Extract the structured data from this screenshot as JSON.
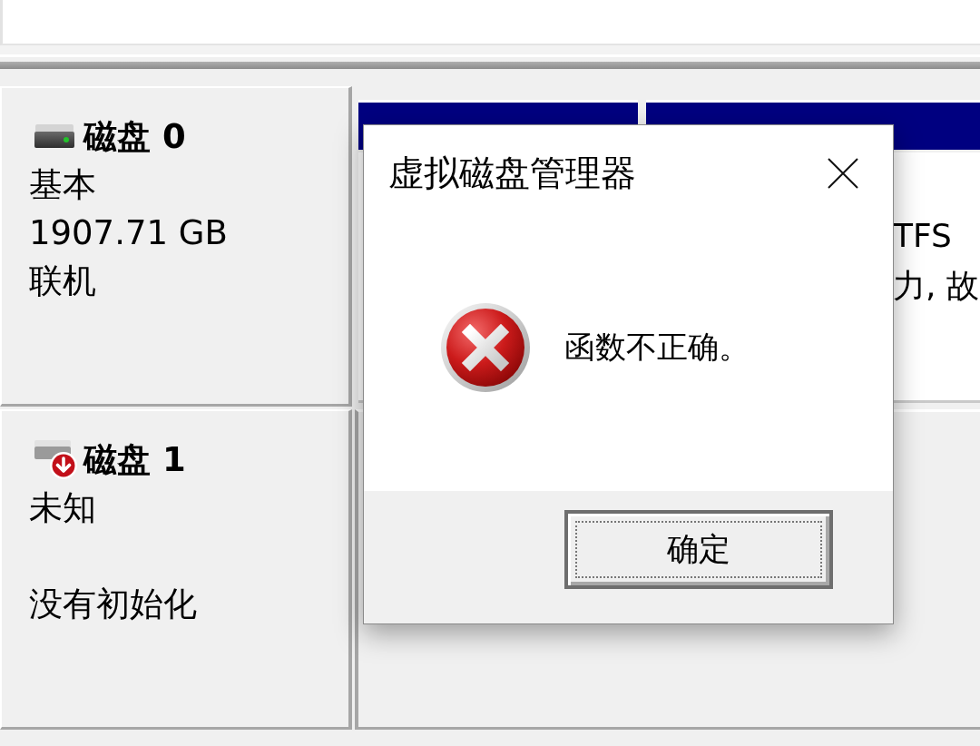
{
  "disks": [
    {
      "kind": "online",
      "name": "磁盘 0",
      "type": "基本",
      "size": "1907.71 GB",
      "status": "联机",
      "partitions": [
        {
          "kind": "primary"
        },
        {
          "kind": "primary",
          "lines": [
            "TFS",
            "力, 故"
          ]
        }
      ]
    },
    {
      "kind": "not_initialized",
      "name": "磁盘 1",
      "type": "未知",
      "status": "没有初始化"
    }
  ],
  "dialog": {
    "kind": "error",
    "title": "虚拟磁盘管理器",
    "message": "函数不正确。",
    "buttons": [
      {
        "label": "确定",
        "focused": true
      }
    ]
  }
}
